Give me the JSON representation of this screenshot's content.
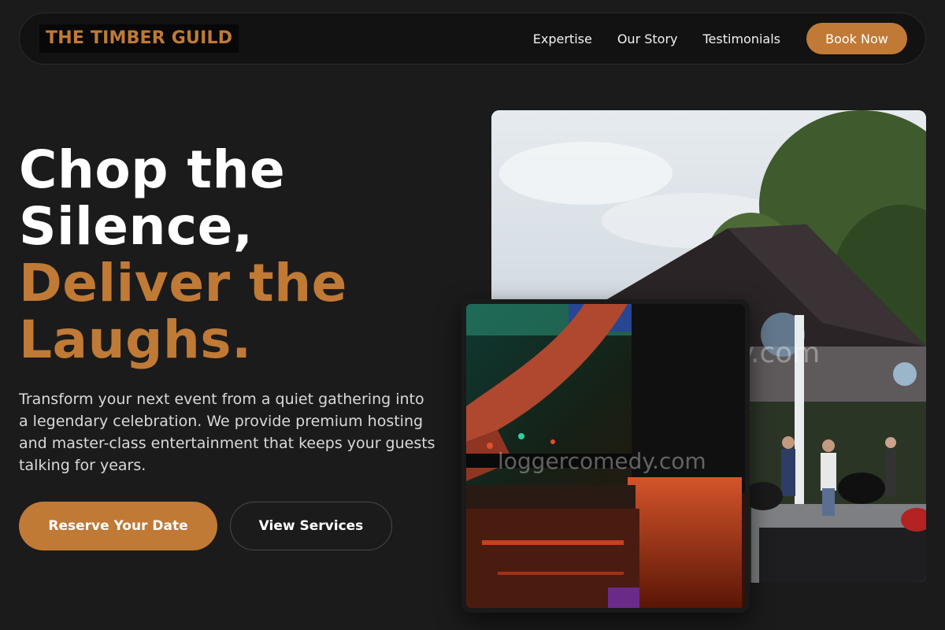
{
  "nav": {
    "logo": "THE TIMBER GUILD",
    "links": [
      "Expertise",
      "Our Story",
      "Testimonials"
    ],
    "cta": "Book Now"
  },
  "hero": {
    "title_line1": "Chop the",
    "title_line2": "Silence,",
    "title_line3": "Deliver the",
    "title_line4": "Laughs.",
    "description": "Transform your next event from a quiet gathering into a legendary celebration. We provide premium hosting and master-class entertainment that keeps your guests talking for years.",
    "primary_button": "Reserve Your Date",
    "secondary_button": "View Services"
  },
  "images": {
    "large_watermark": "dy.com",
    "small_watermark": "loggercomedy.com"
  },
  "colors": {
    "background": "#1b1b1b",
    "accent": "#c07a36",
    "text": "#ffffff"
  }
}
